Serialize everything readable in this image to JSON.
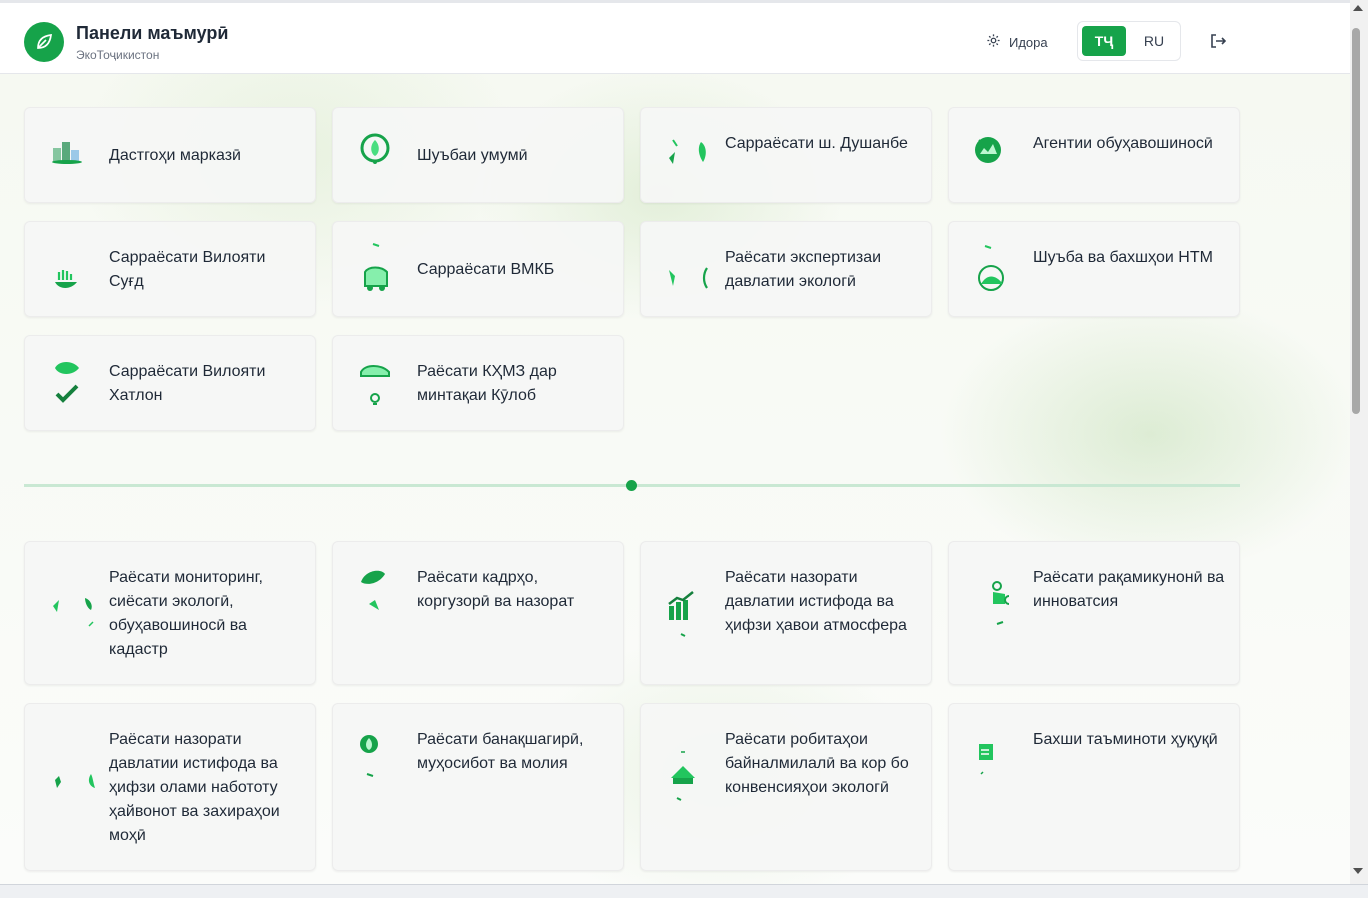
{
  "header": {
    "title": "Панели маъмурӣ",
    "subtitle": "ЭкоТоҷикистон",
    "org_label": "Идора",
    "lang_tj": "ТҶ",
    "lang_ru": "RU"
  },
  "colors": {
    "accent": "#16a34a",
    "divider": "#c9e8d3",
    "card_bg": "#f5f6f5"
  },
  "group1": [
    {
      "label": "Дастгоҳи марказӣ",
      "icon": "city-icon"
    },
    {
      "label": "Шуъбаи умумӣ",
      "icon": "eco-recycle-icon"
    },
    {
      "label": "Сарраёсати ш. Душанбе",
      "icon": "leaves-icon"
    },
    {
      "label": "Агентии обуҳавошиносӣ",
      "icon": "globe-eco-icon"
    },
    {
      "label": "Сарраёсати Вилояти Суғд",
      "icon": "hand-plant-icon"
    },
    {
      "label": "Сарраёсати ВМКБ",
      "icon": "eco-truck-icon"
    },
    {
      "label": "Раёсати экспертизаи давлатии экологӣ",
      "icon": "leaves-icon"
    },
    {
      "label": "Шуъба ва бахшҳои НТМ",
      "icon": "eco-globe-icon"
    },
    {
      "label": "Сарраёсати Вилояти Хатлон",
      "icon": "leaf-check-icon"
    },
    {
      "label": "Раёсати КҲМЗ дар минтақаи Кӯлоб",
      "icon": "eco-car-icon"
    }
  ],
  "group2": [
    {
      "label": "Раёсати мониторинг, сиёсати экологӣ, обуҳавошиносӣ ва кадастр",
      "icon": "leaves-icon"
    },
    {
      "label": "Раёсати кадрҳо, коргузорӣ ва назорат",
      "icon": "leaf-icon"
    },
    {
      "label": "Раёсати назорати давлатии истифода ва ҳифзи ҳавои атмосфера",
      "icon": "growth-chart-icon"
    },
    {
      "label": "Раёсати рақамикунонӣ ва инноватсия",
      "icon": "innovation-gear-icon"
    },
    {
      "label": "Раёсати назорати давлатии истифода ва ҳифзи олами набототу ҳайвонот ва захираҳои моҳӣ",
      "icon": "leaves-icon"
    },
    {
      "label": "Раёсати банақшагирӣ, муҳосибот ва молия",
      "icon": "leaf-money-icon"
    },
    {
      "label": "Раёсати робитаҳои байналмилалӣ ва кор бо конвенсияҳои экологӣ",
      "icon": "eco-building-icon"
    },
    {
      "label": "Бахши таъминоти ҳуқуқӣ",
      "icon": "legal-doc-icon"
    }
  ]
}
